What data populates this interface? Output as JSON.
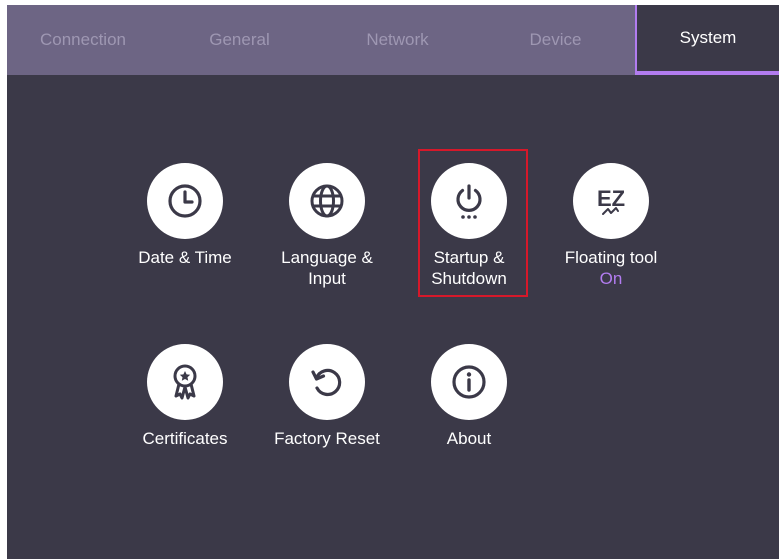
{
  "tabs": [
    {
      "label": "Connection"
    },
    {
      "label": "General"
    },
    {
      "label": "Network"
    },
    {
      "label": "Device"
    },
    {
      "label": "System"
    }
  ],
  "active_tab": "System",
  "items": {
    "date_time": {
      "label": "Date & Time",
      "icon": "clock-icon"
    },
    "language": {
      "label": "Language &\nInput",
      "icon": "globe-icon"
    },
    "startup": {
      "label": "Startup &\nShutdown",
      "icon": "power-icon"
    },
    "floating": {
      "label": "Floating tool",
      "value": "On",
      "icon": "ez-pen-icon",
      "icon_text": "EZ"
    },
    "certificates": {
      "label": "Certificates",
      "icon": "award-ribbon-icon"
    },
    "factory_reset": {
      "label": "Factory Reset",
      "icon": "reset-arrow-icon"
    },
    "about": {
      "label": "About",
      "icon": "info-icon"
    }
  },
  "colors": {
    "tabbar": "#6d6584",
    "background": "#3b3948",
    "accent": "#b27cf0",
    "highlight": "#d6182a"
  }
}
